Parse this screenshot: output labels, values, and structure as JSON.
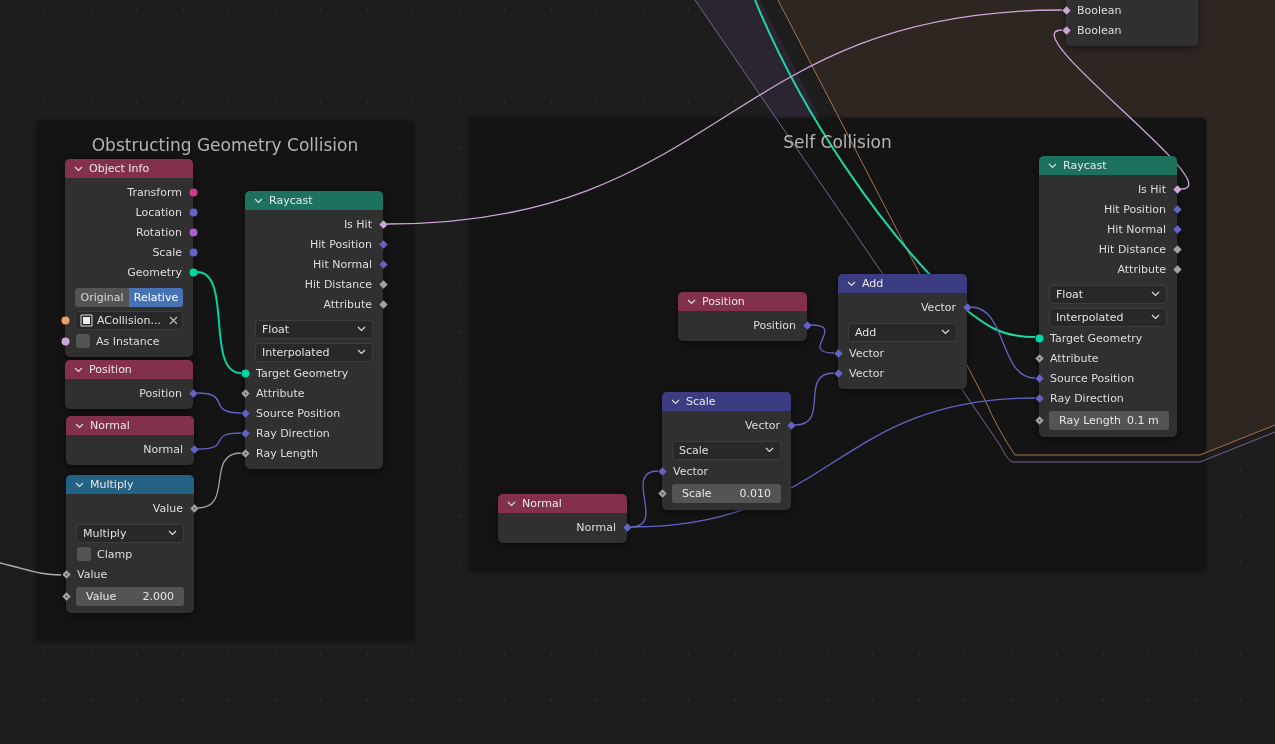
{
  "frames": [
    {
      "title": "Obstructing Geometry Collision"
    },
    {
      "title": "Self Collision"
    }
  ],
  "nodes": [
    {
      "rows": [
        {
          "kind": "input",
          "label": "Boolean",
          "socket": {
            "kind": "diamond",
            "color": "#cca6d6"
          }
        },
        {
          "kind": "input",
          "label": "Boolean",
          "socket": {
            "kind": "diamond",
            "color": "#cca6d6"
          }
        }
      ]
    },
    {
      "title": "Object Info",
      "color": "#83314a",
      "rows": [
        {
          "kind": "output",
          "label": "Transform",
          "socket": {
            "kind": "circle",
            "color": "#cc3a89"
          }
        },
        {
          "kind": "output",
          "label": "Location",
          "socket": {
            "kind": "circle",
            "color": "#6363c7"
          }
        },
        {
          "kind": "output",
          "label": "Rotation",
          "socket": {
            "kind": "circle",
            "color": "#a663c7"
          }
        },
        {
          "kind": "output",
          "label": "Scale",
          "socket": {
            "kind": "circle",
            "color": "#6363c7"
          }
        },
        {
          "kind": "output",
          "label": "Geometry",
          "socket": {
            "kind": "circle",
            "color": "#00d6a3"
          }
        },
        {
          "kind": "toggle",
          "options": [
            {
              "label": "Original",
              "selected": false
            },
            {
              "label": "Relative",
              "selected": true
            }
          ]
        },
        {
          "kind": "object",
          "value": "ACollision...",
          "socket": {
            "kind": "circle",
            "color": "#ed9e6c"
          }
        },
        {
          "kind": "checkbox",
          "label": "As Instance",
          "checked": false,
          "socket": {
            "kind": "circle",
            "color": "#cca6d6"
          }
        }
      ]
    },
    {
      "title": "Raycast",
      "color": "#1d725e",
      "rows": [
        {
          "kind": "output",
          "label": "Is Hit",
          "socket": {
            "kind": "diamond",
            "color": "#cca6d6"
          }
        },
        {
          "kind": "output",
          "label": "Hit Position",
          "socket": {
            "kind": "diamond",
            "color": "#6363c7"
          }
        },
        {
          "kind": "output",
          "label": "Hit Normal",
          "socket": {
            "kind": "diamond",
            "color": "#6363c7"
          }
        },
        {
          "kind": "output",
          "label": "Hit Distance",
          "socket": {
            "kind": "diamond",
            "color": "#a1a1a1"
          }
        },
        {
          "kind": "output",
          "label": "Attribute",
          "socket": {
            "kind": "diamond",
            "color": "#a1a1a1"
          }
        },
        {
          "kind": "select",
          "value": "Float"
        },
        {
          "kind": "select",
          "value": "Interpolated"
        },
        {
          "kind": "input",
          "label": "Target Geometry",
          "socket": {
            "kind": "circle",
            "color": "#00d6a3"
          }
        },
        {
          "kind": "input",
          "label": "Attribute",
          "socket": {
            "kind": "hollow",
            "color": "#a1a1a1"
          }
        },
        {
          "kind": "input",
          "label": "Source Position",
          "socket": {
            "kind": "diamond",
            "color": "#6363c7"
          }
        },
        {
          "kind": "input",
          "label": "Ray Direction",
          "socket": {
            "kind": "diamond",
            "color": "#6363c7"
          }
        },
        {
          "kind": "input",
          "label": "Ray Length",
          "socket": {
            "kind": "hollow",
            "color": "#a1a1a1"
          }
        }
      ]
    },
    {
      "title": "Position",
      "color": "#83314a",
      "rows": [
        {
          "kind": "output",
          "label": "Position",
          "socket": {
            "kind": "diamond",
            "color": "#6363c7"
          }
        }
      ]
    },
    {
      "title": "Normal",
      "color": "#83314a",
      "rows": [
        {
          "kind": "output",
          "label": "Normal",
          "socket": {
            "kind": "diamond",
            "color": "#6363c7"
          }
        }
      ]
    },
    {
      "title": "Multiply",
      "color": "#246283",
      "rows": [
        {
          "kind": "output",
          "label": "Value",
          "socket": {
            "kind": "hollow",
            "color": "#a1a1a1"
          }
        },
        {
          "kind": "select",
          "value": "Multiply"
        },
        {
          "kind": "checkbox",
          "label": "Clamp",
          "checked": false
        },
        {
          "kind": "input",
          "label": "Value",
          "socket": {
            "kind": "hollow",
            "color": "#a1a1a1"
          }
        },
        {
          "kind": "field",
          "label": "Value",
          "value": "2.000",
          "socket": {
            "kind": "hollow",
            "color": "#a1a1a1"
          }
        }
      ]
    },
    {
      "title": "Position",
      "color": "#83314a",
      "rows": [
        {
          "kind": "output",
          "label": "Position",
          "socket": {
            "kind": "diamond",
            "color": "#6363c7"
          }
        }
      ]
    },
    {
      "title": "Add",
      "color": "#3c3c83",
      "rows": [
        {
          "kind": "output",
          "label": "Vector",
          "socket": {
            "kind": "diamond",
            "color": "#6363c7"
          }
        },
        {
          "kind": "select",
          "value": "Add"
        },
        {
          "kind": "input",
          "label": "Vector",
          "socket": {
            "kind": "diamond",
            "color": "#6363c7"
          }
        },
        {
          "kind": "input",
          "label": "Vector",
          "socket": {
            "kind": "diamond",
            "color": "#6363c7"
          }
        }
      ]
    },
    {
      "title": "Scale",
      "color": "#3c3c83",
      "rows": [
        {
          "kind": "output",
          "label": "Vector",
          "socket": {
            "kind": "diamond",
            "color": "#6363c7"
          }
        },
        {
          "kind": "select",
          "value": "Scale"
        },
        {
          "kind": "input",
          "label": "Vector",
          "socket": {
            "kind": "diamond",
            "color": "#6363c7"
          }
        },
        {
          "kind": "field",
          "label": "Scale",
          "value": "0.010",
          "socket": {
            "kind": "hollow",
            "color": "#a1a1a1"
          }
        }
      ]
    },
    {
      "title": "Normal",
      "color": "#83314a",
      "rows": [
        {
          "kind": "output",
          "label": "Normal",
          "socket": {
            "kind": "diamond",
            "color": "#6363c7"
          }
        }
      ]
    },
    {
      "title": "Raycast",
      "color": "#1d725e",
      "rows": [
        {
          "kind": "output",
          "label": "Is Hit",
          "socket": {
            "kind": "diamond",
            "color": "#cca6d6"
          }
        },
        {
          "kind": "output",
          "label": "Hit Position",
          "socket": {
            "kind": "diamond",
            "color": "#6363c7"
          }
        },
        {
          "kind": "output",
          "label": "Hit Normal",
          "socket": {
            "kind": "diamond",
            "color": "#6363c7"
          }
        },
        {
          "kind": "output",
          "label": "Hit Distance",
          "socket": {
            "kind": "diamond",
            "color": "#a1a1a1"
          }
        },
        {
          "kind": "output",
          "label": "Attribute",
          "socket": {
            "kind": "diamond",
            "color": "#a1a1a1"
          }
        },
        {
          "kind": "select",
          "value": "Float"
        },
        {
          "kind": "select",
          "value": "Interpolated"
        },
        {
          "kind": "input",
          "label": "Target Geometry",
          "socket": {
            "kind": "circle",
            "color": "#00d6a3"
          }
        },
        {
          "kind": "input",
          "label": "Attribute",
          "socket": {
            "kind": "hollow",
            "color": "#a1a1a1"
          }
        },
        {
          "kind": "input",
          "label": "Source Position",
          "socket": {
            "kind": "diamond",
            "color": "#6363c7"
          }
        },
        {
          "kind": "input",
          "label": "Ray Direction",
          "socket": {
            "kind": "diamond",
            "color": "#6363c7"
          }
        },
        {
          "kind": "field",
          "label": "Ray Length",
          "value": "0.1 m",
          "socket": {
            "kind": "hollow",
            "color": "#a1a1a1"
          }
        }
      ]
    }
  ]
}
